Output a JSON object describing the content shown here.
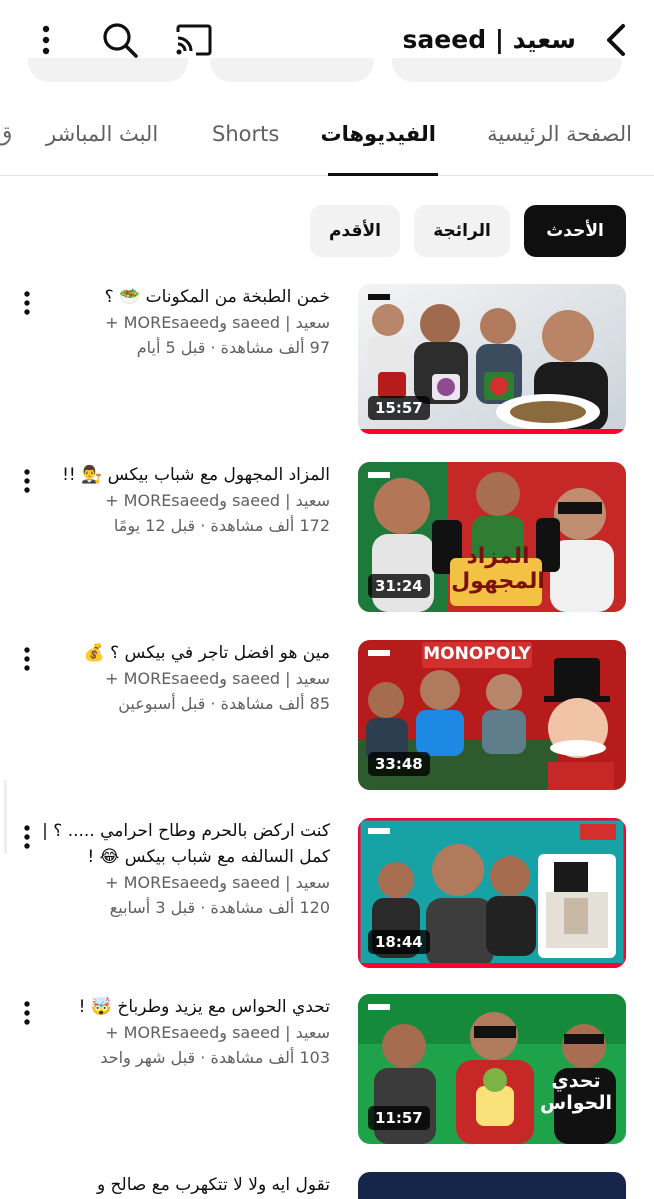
{
  "header": {
    "channel_name": "سعيد | saeed",
    "back_icon": "chevron-left-icon",
    "cast_icon": "cast-icon",
    "search_icon": "search-icon",
    "menu_icon": "more-vert-icon"
  },
  "tabs": [
    {
      "label": "الصفحة الرئيسية",
      "active": false
    },
    {
      "label": "الفيديوهات",
      "active": true
    },
    {
      "label": "Shorts",
      "active": false
    },
    {
      "label": "البث المباشر",
      "active": false
    },
    {
      "label": "ق",
      "active": false
    }
  ],
  "sort_chips": [
    {
      "label": "الأحدث",
      "active": true
    },
    {
      "label": "الرائجة",
      "active": false
    },
    {
      "label": "الأقدم",
      "active": false
    }
  ],
  "videos": [
    {
      "title": "خمن الطبخة من المكونات 🥗 ؟",
      "channel": "سعيد | saeed وMOREsaeed +",
      "stats": "97 ألف مشاهدة · قبل 5 أيام",
      "duration": "15:57"
    },
    {
      "title": "المزاد المجهول مع شباب بيكس 👨‍⚖️ !!",
      "channel": "سعيد | saeed وMOREsaeed +",
      "stats": "172 ألف مشاهدة · قبل 12 يومًا",
      "duration": "31:24",
      "thumb_text": "المزاد المجهول"
    },
    {
      "title": "مين هو افضل تاجر في بيكس ؟ 💰",
      "channel": "سعيد | saeed وMOREsaeed +",
      "stats": "85 ألف مشاهدة · قبل أسبوعين",
      "duration": "33:48",
      "thumb_text": "MONOPOLY"
    },
    {
      "title": "كنت اركض بالحرم وطاح احرامي ..... ؟ | كمل السالفه مع شباب بيكس 😂 !",
      "channel": "سعيد | saeed وMOREsaeed +",
      "stats": "120 ألف مشاهدة · قبل 3 أسابيع",
      "duration": "18:44"
    },
    {
      "title": "تحدي الحواس مع يزيد وطرباخ 🤯 !",
      "channel": "سعيد | saeed وMOREsaeed +",
      "stats": "103 ألف مشاهدة · قبل شهر واحد",
      "duration": "11:57",
      "thumb_text": "تحدي الحواس"
    },
    {
      "title": "تقول ايه ولا لا تتكهرب مع صالح و"
    }
  ],
  "colors": {
    "accent_red": "#ff0033",
    "text_primary": "#0f0f0f",
    "text_secondary": "#606060",
    "chip_bg": "#f2f2f2"
  }
}
